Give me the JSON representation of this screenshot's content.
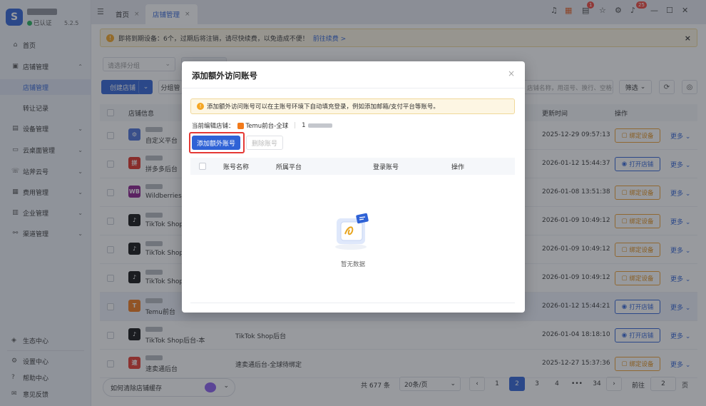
{
  "app": {
    "version": "5.2.5",
    "verified_label": "已认证",
    "logo_glyph": "S"
  },
  "sidebar": {
    "items": [
      {
        "label": "首页",
        "icon": "home-icon",
        "glyph": "⌂"
      },
      {
        "label": "店铺管理",
        "icon": "store-icon",
        "glyph": "▣",
        "expanded": true
      },
      {
        "label": "店铺管理",
        "sub": true,
        "active": true
      },
      {
        "label": "转让记录",
        "sub": true
      },
      {
        "label": "设备管理",
        "icon": "device-icon",
        "glyph": "▤"
      },
      {
        "label": "云桌面管理",
        "icon": "cloud-desktop-icon",
        "glyph": "▭"
      },
      {
        "label": "站斧云号",
        "icon": "phone-icon",
        "glyph": "☏"
      },
      {
        "label": "费用管理",
        "icon": "fee-icon",
        "glyph": "▦"
      },
      {
        "label": "企业管理",
        "icon": "enterprise-icon",
        "glyph": "▥"
      },
      {
        "label": "渠道管理",
        "icon": "channel-icon",
        "glyph": "⚯"
      }
    ],
    "bottom": [
      {
        "label": "生态中心",
        "icon": "ecosystem-icon",
        "glyph": "◈"
      },
      {
        "label": "设置中心",
        "icon": "settings-icon",
        "glyph": "⚙"
      },
      {
        "label": "帮助中心",
        "icon": "help-icon",
        "glyph": "?"
      },
      {
        "label": "意见反馈",
        "icon": "feedback-icon",
        "glyph": "✉"
      }
    ]
  },
  "tabs": [
    {
      "label": "首页",
      "close": "×"
    },
    {
      "label": "店铺管理",
      "close": "×",
      "active": true
    }
  ],
  "topbar": {
    "badges": {
      "doc": "1",
      "bell": "25"
    }
  },
  "notice": {
    "text": "即将到期设备：6个，过期后将注销，请尽快续费，以免造成不便！",
    "link": "前往续费 >",
    "close": "×"
  },
  "toolbar": {
    "group_placeholder": "请选择分组",
    "create_label": "创建店铺",
    "group_label": "分组管",
    "search_placeholder": "店铺名称，用逗号、换行、空格分开的多名称查询",
    "filter_label": "筛选"
  },
  "table": {
    "headers": [
      "店铺信息",
      "更新时间",
      "操作"
    ],
    "rows": [
      {
        "icon_text": "⚙",
        "icon_color": "#4a6fd8",
        "name": "自定义平台",
        "extra": "",
        "time": "2025-12-29 09:57:13",
        "action": "绑定设备",
        "action_type": "bind",
        "more": "更多"
      },
      {
        "icon_text": "拼",
        "icon_color": "#e02e24",
        "name": "拼多多后台",
        "extra": "",
        "time": "2026-01-12 15:44:37",
        "action": "打开店铺",
        "action_type": "open",
        "more": "更多"
      },
      {
        "icon_text": "WB",
        "icon_color": "#8a1b8c",
        "name": "Wildberries",
        "extra": "",
        "time": "2026-01-08 13:51:38",
        "action": "绑定设备",
        "action_type": "bind",
        "more": "更多"
      },
      {
        "icon_text": "♪",
        "icon_color": "#111111",
        "name": "TikTok Shop",
        "extra": "",
        "time": "2026-01-09 10:49:12",
        "action": "绑定设备",
        "action_type": "bind",
        "more": "更多"
      },
      {
        "icon_text": "♪",
        "icon_color": "#111111",
        "name": "TikTok Shop",
        "extra": "",
        "time": "2026-01-09 10:49:12",
        "action": "绑定设备",
        "action_type": "bind",
        "more": "更多"
      },
      {
        "icon_text": "♪",
        "icon_color": "#111111",
        "name": "TikTok Shop",
        "extra": "",
        "time": "2026-01-09 10:49:12",
        "action": "绑定设备",
        "action_type": "bind",
        "more": "更多"
      },
      {
        "icon_text": "T",
        "icon_color": "#f27a1a",
        "name": "Temu前台",
        "extra": "",
        "time": "2026-01-12 15:44:21",
        "action": "打开店铺",
        "action_type": "open",
        "more": "更多",
        "highlight": true
      },
      {
        "icon_text": "♪",
        "icon_color": "#111111",
        "name": "TikTok Shop后台-本",
        "extra": "TikTok Shop后台",
        "time": "2026-01-04 18:18:10",
        "action": "打开店铺",
        "action_type": "open",
        "more": "更多"
      },
      {
        "icon_text": "速",
        "icon_color": "#e8382c",
        "name": "速卖通后台",
        "extra": "速卖通后台-全球",
        "extra2": "待绑定",
        "time": "2025-12-27 15:37:36",
        "action": "绑定设备",
        "action_type": "bind",
        "more": "更多"
      }
    ]
  },
  "pagination": {
    "total": "共 677 条",
    "page_size": "20条/页",
    "pages": [
      "1",
      "2",
      "3",
      "4",
      "•••",
      "34"
    ],
    "prev": "‹",
    "next": "›",
    "goto_label": "前往",
    "goto_value": "2",
    "page_suffix": "页"
  },
  "clear_cache": "如何清除店铺缓存",
  "modal": {
    "title": "添加额外访问账号",
    "close": "×",
    "tip": "添加额外访问账号可以在主账号环境下自动填充登录，例如添加邮箱/支付平台等账号。",
    "current_store_label": "当前编辑店铺：",
    "current_store_name": "Temu前台-全球",
    "current_store_id": "1",
    "add_button": "添加额外账号",
    "delete_button": "删除账号",
    "headers": [
      "账号名称",
      "所属平台",
      "登录账号",
      "操作"
    ],
    "empty_text": "暂无数据"
  },
  "colors": {
    "primary": "#2f62d6",
    "warning": "#f5a623",
    "highlight_border": "#e53935"
  }
}
